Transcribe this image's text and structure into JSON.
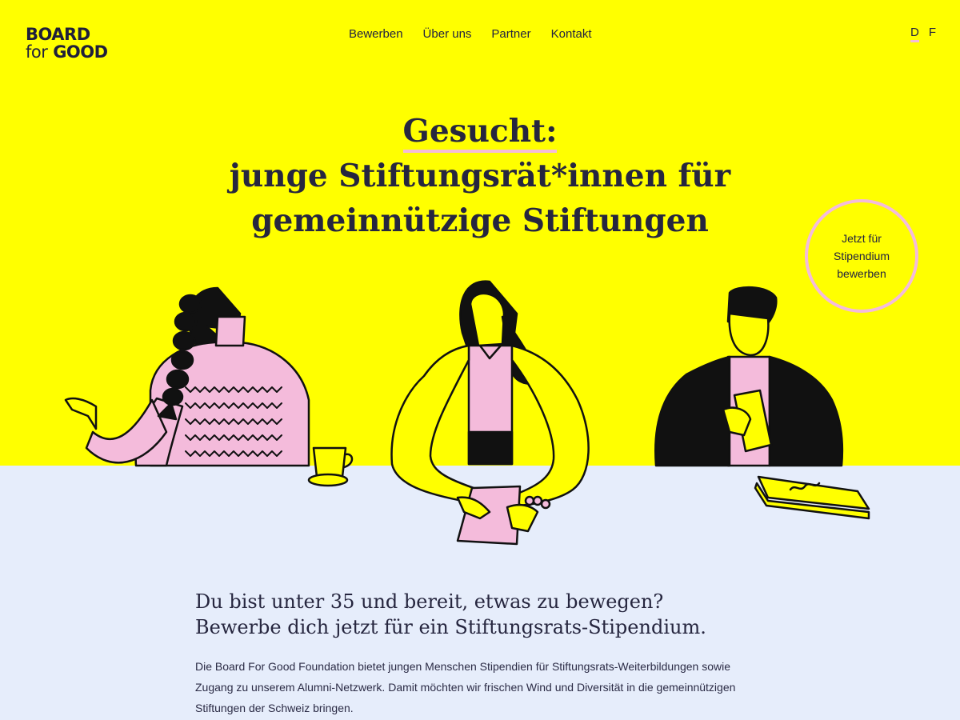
{
  "brand": {
    "line1": "BOARD",
    "line2_small": "for",
    "line2_bold": "GOOD"
  },
  "nav": [
    "Bewerben",
    "Über uns",
    "Partner",
    "Kontakt"
  ],
  "languages": {
    "active": "D",
    "other": "F"
  },
  "hero": {
    "kicker": "Gesucht:",
    "line2": "junge Stiftungsrät*innen für",
    "line3": "gemeinnützige Stiftungen"
  },
  "cta": {
    "label": "Jetzt für Stipendium bewerben"
  },
  "intro": {
    "heading_line1": "Du bist unter 35 und bereit, etwas zu bewegen?",
    "heading_line2": "Bewerbe dich jetzt für ein Stiftungsrats-Stipendium.",
    "body": "Die Board For Good Foundation bietet jungen Menschen Stipendien für Stiftungsrats-Weiterbildungen sowie Zugang zu unserem Alumni-Netzwerk. Damit möchten wir frischen Wind und Diversität in die gemeinnützigen Stiftungen der Schweiz bringen."
  },
  "colors": {
    "yellow": "#ffff00",
    "pink": "#f4bbdb",
    "lightblue": "#e6edfb",
    "ink": "#1f1f3a"
  }
}
